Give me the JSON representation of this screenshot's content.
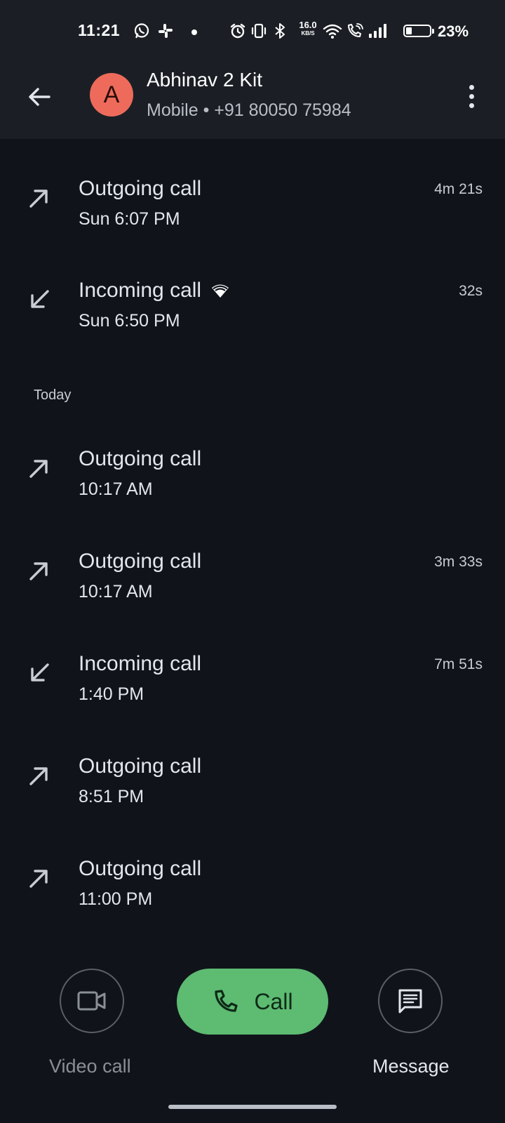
{
  "status_bar": {
    "time": "11:21",
    "net_speed": "16.0",
    "net_unit": "KB/S",
    "battery": "23%",
    "icons": [
      "whatsapp-icon",
      "slack-icon",
      "notification-dot",
      "alarm-icon",
      "vibrate-icon",
      "bluetooth-icon",
      "wifi-icon",
      "wifi-calling-icon",
      "signal-icon",
      "battery-icon"
    ]
  },
  "header": {
    "avatar_letter": "A",
    "name": "Abhinav 2 Kit",
    "subtitle": "Mobile • +91 80050 75984",
    "avatar_color": "#ee6b5b"
  },
  "calls": [
    {
      "type": "Outgoing call",
      "time": "Sun 6:07 PM",
      "duration": "4m 21s",
      "direction": "outgoing",
      "wifi": false
    },
    {
      "type": "Incoming call",
      "time": "Sun 6:50 PM",
      "duration": "32s",
      "direction": "incoming",
      "wifi": true
    }
  ],
  "today_label": "Today",
  "today_calls": [
    {
      "type": "Outgoing call",
      "time": "10:17 AM",
      "duration": "",
      "direction": "outgoing"
    },
    {
      "type": "Outgoing call",
      "time": "10:17 AM",
      "duration": "3m 33s",
      "direction": "outgoing"
    },
    {
      "type": "Incoming call",
      "time": "1:40 PM",
      "duration": "7m 51s",
      "direction": "incoming"
    },
    {
      "type": "Outgoing call",
      "time": "8:51 PM",
      "duration": "",
      "direction": "outgoing"
    },
    {
      "type": "Outgoing call",
      "time": "11:00 PM",
      "duration": "",
      "direction": "outgoing"
    }
  ],
  "actions": {
    "video_call": "Video call",
    "call": "Call",
    "message": "Message"
  },
  "colors": {
    "background": "#10141a",
    "app_bar": "#1b1f25",
    "call_button": "#5dbb72"
  }
}
